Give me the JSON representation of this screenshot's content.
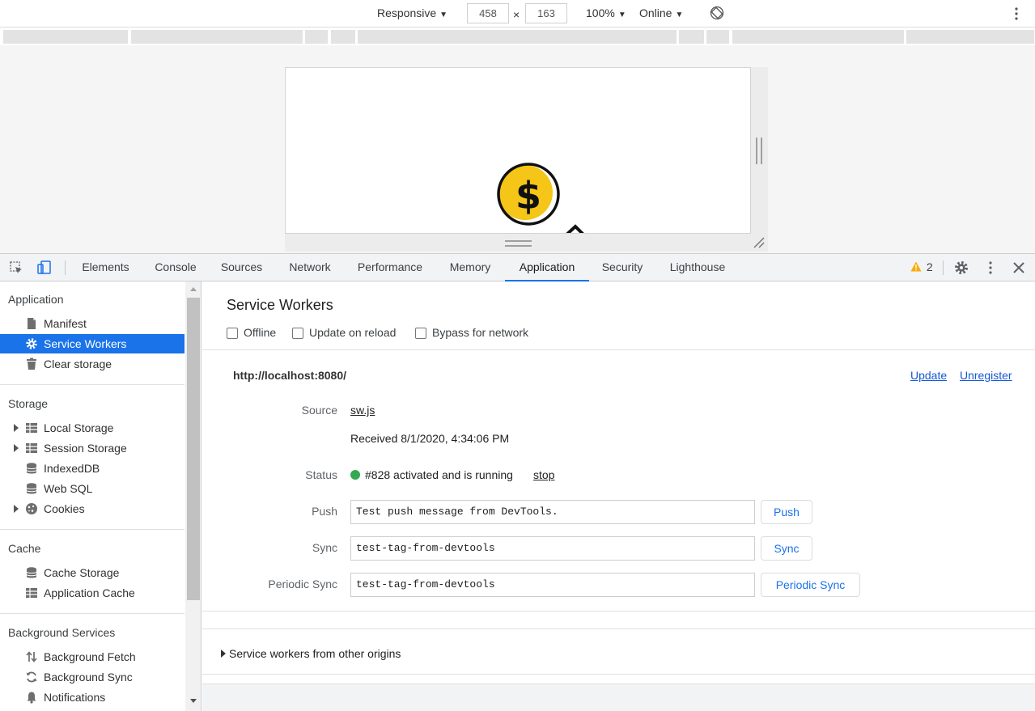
{
  "device_toolbar": {
    "device": "Responsive",
    "width": "458",
    "height": "163",
    "times": "×",
    "zoom": "100%",
    "network": "Online",
    "caret": "▼",
    "rotate_icon": "rotate-icon",
    "more_icon": "more-vert-icon"
  },
  "tabs": [
    {
      "label": "Elements"
    },
    {
      "label": "Console"
    },
    {
      "label": "Sources"
    },
    {
      "label": "Network"
    },
    {
      "label": "Performance"
    },
    {
      "label": "Memory"
    },
    {
      "label": "Application",
      "active": true
    },
    {
      "label": "Security"
    },
    {
      "label": "Lighthouse"
    }
  ],
  "warnings": {
    "count": "2"
  },
  "sidebar": {
    "sections": [
      {
        "title": "Application",
        "items": [
          {
            "label": "Manifest",
            "icon": "file-icon"
          },
          {
            "label": "Service Workers",
            "icon": "gear-icon",
            "selected": true
          },
          {
            "label": "Clear storage",
            "icon": "trash-icon"
          }
        ]
      },
      {
        "title": "Storage",
        "items": [
          {
            "label": "Local Storage",
            "icon": "table-icon",
            "expandable": true
          },
          {
            "label": "Session Storage",
            "icon": "table-icon",
            "expandable": true
          },
          {
            "label": "IndexedDB",
            "icon": "database-icon"
          },
          {
            "label": "Web SQL",
            "icon": "database-icon"
          },
          {
            "label": "Cookies",
            "icon": "cookie-icon",
            "expandable": true
          }
        ]
      },
      {
        "title": "Cache",
        "items": [
          {
            "label": "Cache Storage",
            "icon": "database-icon"
          },
          {
            "label": "Application Cache",
            "icon": "table-icon"
          }
        ]
      },
      {
        "title": "Background Services",
        "items": [
          {
            "label": "Background Fetch",
            "icon": "fetch-arrows-icon"
          },
          {
            "label": "Background Sync",
            "icon": "sync-icon"
          },
          {
            "label": "Notifications",
            "icon": "bell-icon"
          }
        ]
      }
    ]
  },
  "main": {
    "title": "Service Workers",
    "options": [
      "Offline",
      "Update on reload",
      "Bypass for network"
    ],
    "origin": "http://localhost:8080/",
    "update_label": "Update",
    "unregister_label": "Unregister",
    "source_label": "Source",
    "source_file": "sw.js",
    "received": "Received 8/1/2020, 4:34:06 PM",
    "status_label": "Status",
    "status_text": "#828 activated and is running",
    "stop_label": "stop",
    "status_color": "#34a853",
    "push_label": "Push",
    "push_value": "Test push message from DevTools.",
    "push_button": "Push",
    "sync_label": "Sync",
    "sync_value": "test-tag-from-devtools",
    "sync_button": "Sync",
    "periodic_label": "Periodic Sync",
    "periodic_value": "test-tag-from-devtools",
    "periodic_button": "Periodic Sync",
    "other_origins": "Service workers from other origins"
  },
  "colors": {
    "accent": "#1a73e8",
    "warning": "#f9ab00",
    "coin": "#f5c518"
  }
}
